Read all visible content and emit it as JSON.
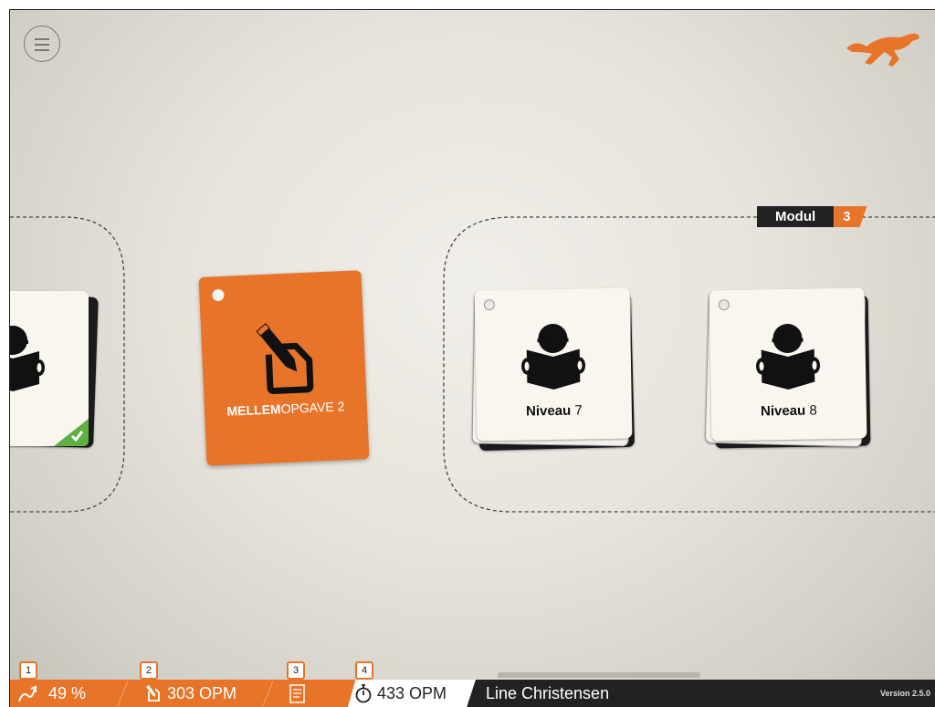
{
  "header": {
    "menu_icon": "hamburger-icon",
    "logo_icon": "cheetah-logo-icon"
  },
  "module": {
    "label": "Modul",
    "number": "3"
  },
  "cards": [
    {
      "prefix": "au",
      "level": "6",
      "icon": "reader-icon",
      "completed": true
    },
    {
      "title": "MELLEM",
      "title_thin": "OPGAVE 2",
      "icon": "pencil-document-icon"
    },
    {
      "prefix": "Niveau",
      "level": "7",
      "icon": "reader-icon"
    },
    {
      "prefix": "Niveau",
      "level": "8",
      "icon": "reader-icon"
    }
  ],
  "status_bar": {
    "badges": [
      "1",
      "2",
      "3",
      "4"
    ],
    "progress": "49 %",
    "reading_speed": "303 OPM",
    "timer_speed": "433 OPM",
    "user_name": "Line Christensen",
    "version": "Version 2.5.0"
  },
  "colors": {
    "accent": "#e8742a",
    "dark": "#222222",
    "card": "#f8f6ef",
    "done": "#5fb043"
  }
}
